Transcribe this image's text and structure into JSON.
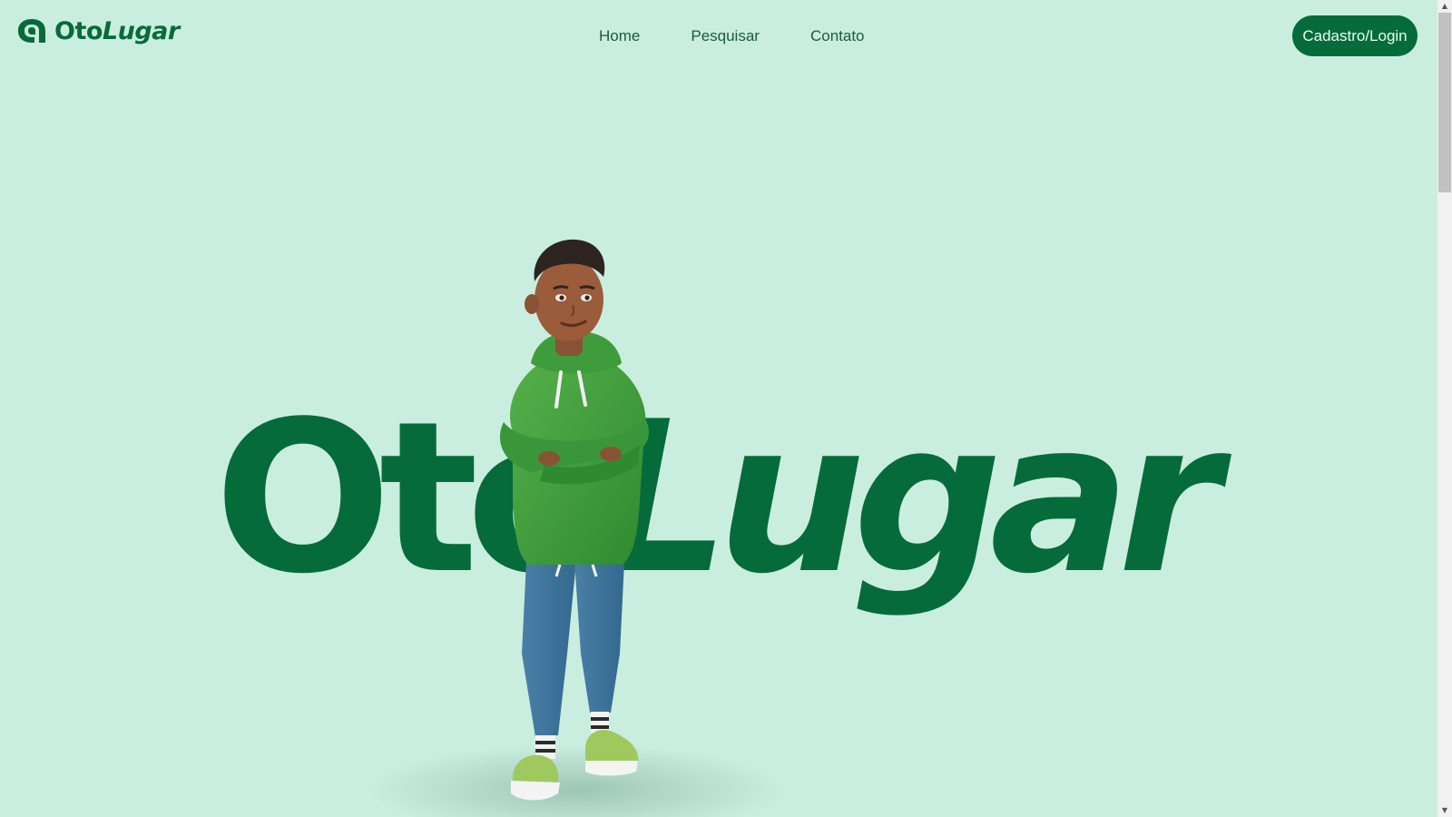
{
  "brand": {
    "name_part1": "Oto",
    "name_part2": "Lugar",
    "primary_color": "#066b3a",
    "background_color": "#c9eedf"
  },
  "nav": {
    "items": [
      {
        "label": "Home"
      },
      {
        "label": "Pesquisar"
      },
      {
        "label": "Contato"
      }
    ],
    "cta_label": "Cadastro/Login"
  },
  "hero": {
    "title_part1": "Oto",
    "title_part2": "Lugar",
    "figure_icon": "person-illustration"
  },
  "scrollbar": {
    "up_icon": "chevron-up-icon",
    "down_icon": "chevron-down-icon"
  }
}
